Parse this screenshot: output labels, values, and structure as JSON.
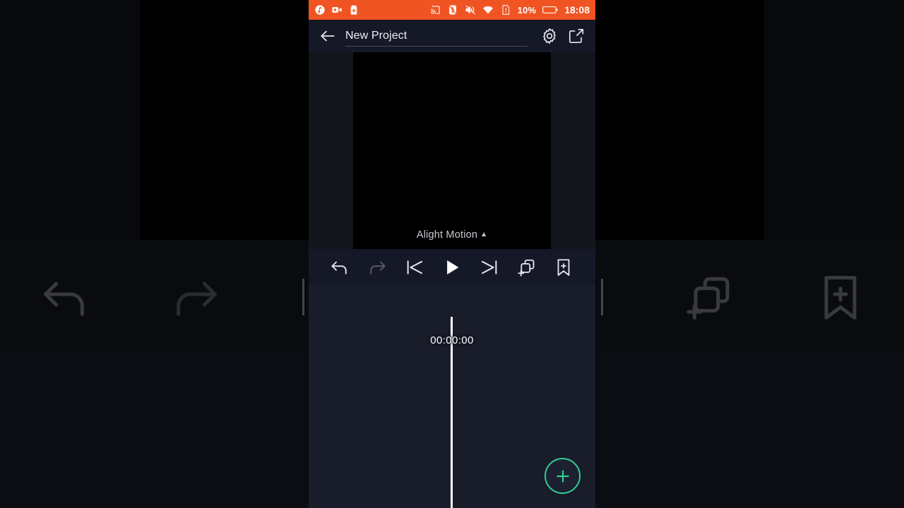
{
  "status_bar": {
    "background_color": "#f05423",
    "left_icons": [
      {
        "name": "music-note-icon"
      },
      {
        "name": "video-camera-icon"
      },
      {
        "name": "battery-plus-icon"
      }
    ],
    "right_icons": [
      {
        "name": "cast-icon"
      },
      {
        "name": "bluetooth-off-icon"
      },
      {
        "name": "volume-muted-icon"
      },
      {
        "name": "wifi-icon"
      },
      {
        "name": "sim-alert-icon"
      }
    ],
    "battery_percent": "10%",
    "battery_icon": "battery-icon",
    "clock": "18:08"
  },
  "app_bar": {
    "back_icon": "back-arrow-icon",
    "project_title": "New Project",
    "project_title_placeholder": "Project name",
    "settings_icon": "gear-icon",
    "export_icon": "export-icon"
  },
  "preview": {
    "watermark_text": "Alight Motion",
    "watermark_caret": "▲",
    "canvas_color": "#000000",
    "background_color": "#12161c"
  },
  "toolbar": {
    "buttons": [
      {
        "name": "undo-button",
        "icon": "undo-icon",
        "enabled": true
      },
      {
        "name": "redo-button",
        "icon": "redo-icon",
        "enabled": false
      },
      {
        "name": "skip-to-start-button",
        "icon": "skip-to-start-icon",
        "enabled": true
      },
      {
        "name": "play-button",
        "icon": "play-icon",
        "enabled": true
      },
      {
        "name": "skip-to-end-button",
        "icon": "skip-to-end-icon",
        "enabled": true
      },
      {
        "name": "add-layer-button",
        "icon": "add-layer-icon",
        "enabled": true
      },
      {
        "name": "add-bookmark-button",
        "icon": "bookmark-plus-icon",
        "enabled": true
      }
    ]
  },
  "timeline": {
    "timecode": "00:00:00",
    "playhead_color": "#ffffff",
    "background_color": "#191c29",
    "add_button": {
      "name": "add-element-fab",
      "icon": "plus-icon",
      "accent_color": "#2ecf93"
    }
  }
}
